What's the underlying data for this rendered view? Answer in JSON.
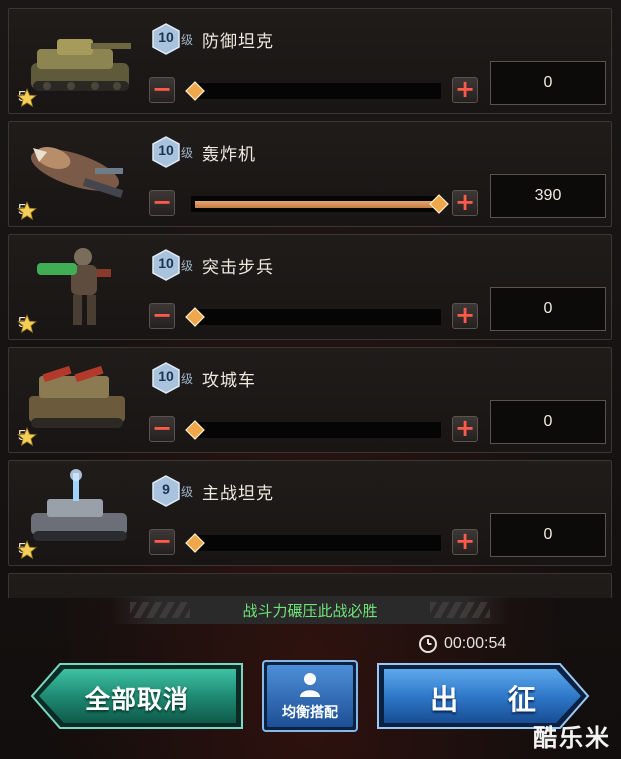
{
  "units": [
    {
      "level": "10",
      "level_suffix": "级",
      "name": "防御坦克",
      "star_count": "5",
      "quantity": "0",
      "fill_fraction": 0.0,
      "icon": "defense-tank-icon"
    },
    {
      "level": "10",
      "level_suffix": "级",
      "name": "轰炸机",
      "star_count": "5",
      "quantity": "390",
      "fill_fraction": 1.0,
      "icon": "bomber-icon"
    },
    {
      "level": "10",
      "level_suffix": "级",
      "name": "突击步兵",
      "star_count": "5",
      "quantity": "0",
      "fill_fraction": 0.0,
      "icon": "assault-infantry-icon"
    },
    {
      "level": "10",
      "level_suffix": "级",
      "name": "攻城车",
      "star_count": "5",
      "quantity": "0",
      "fill_fraction": 0.0,
      "icon": "siege-vehicle-icon"
    },
    {
      "level": "9",
      "level_suffix": "级",
      "name": "主战坦克",
      "star_count": "5",
      "quantity": "0",
      "fill_fraction": 0.0,
      "icon": "main-battle-tank-icon"
    }
  ],
  "status": {
    "power_text": "战斗力碾压此战必胜",
    "timer": "00:00:54"
  },
  "buttons": {
    "cancel_all": "全部取消",
    "balance": "均衡搭配",
    "deploy": "出 征"
  },
  "watermark": "酷乐米",
  "colors": {
    "slider_fill": "#d6925a",
    "knob": "#f0a64a",
    "power_text": "#6fe47a",
    "cancel_button": "#1f8a73",
    "deploy_button": "#2f79c9",
    "minus_plus": "#ff5a4a"
  }
}
